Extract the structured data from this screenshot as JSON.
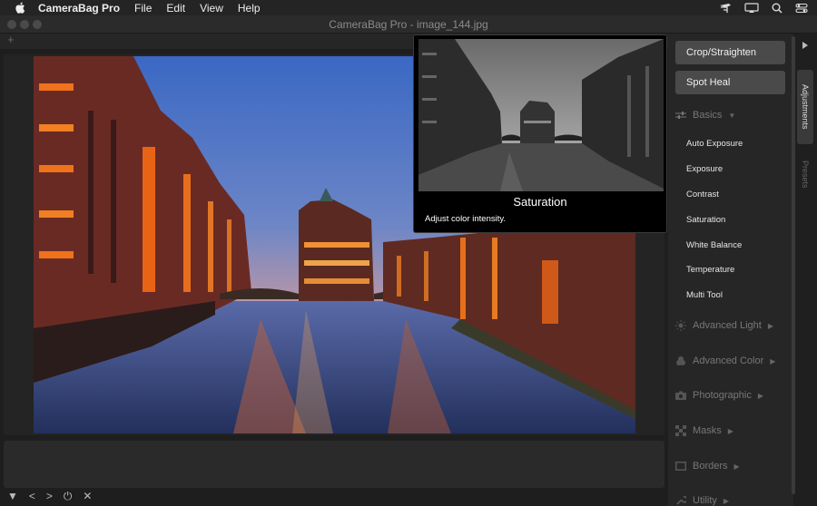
{
  "menubar": {
    "app_name": "CameraBag Pro",
    "items": [
      "File",
      "Edit",
      "View",
      "Help"
    ]
  },
  "window": {
    "title": "CameraBag Pro - image_144.jpg"
  },
  "tooltip": {
    "title": "Saturation",
    "description": "Adjust color intensity."
  },
  "panel": {
    "buttons": [
      "Crop/Straighten",
      "Spot Heal"
    ],
    "basics": {
      "label": "Basics",
      "items": [
        "Auto Exposure",
        "Exposure",
        "Contrast",
        "Saturation",
        "White Balance",
        "Temperature",
        "Multi Tool"
      ]
    },
    "sections": [
      "Advanced Light",
      "Advanced Color",
      "Photographic",
      "Masks",
      "Borders",
      "Utility"
    ]
  },
  "tabs": [
    "Adjustments",
    "Presets"
  ],
  "controls": [
    "▼",
    "<",
    ">",
    "⏻",
    "✕"
  ],
  "colors": {
    "accent_orange": "#ff7a1a",
    "sky_top": "#3f6ec9",
    "sky_bottom": "#f0a072",
    "panel_bg": "#262626",
    "button_bg": "#4a4a4a"
  }
}
